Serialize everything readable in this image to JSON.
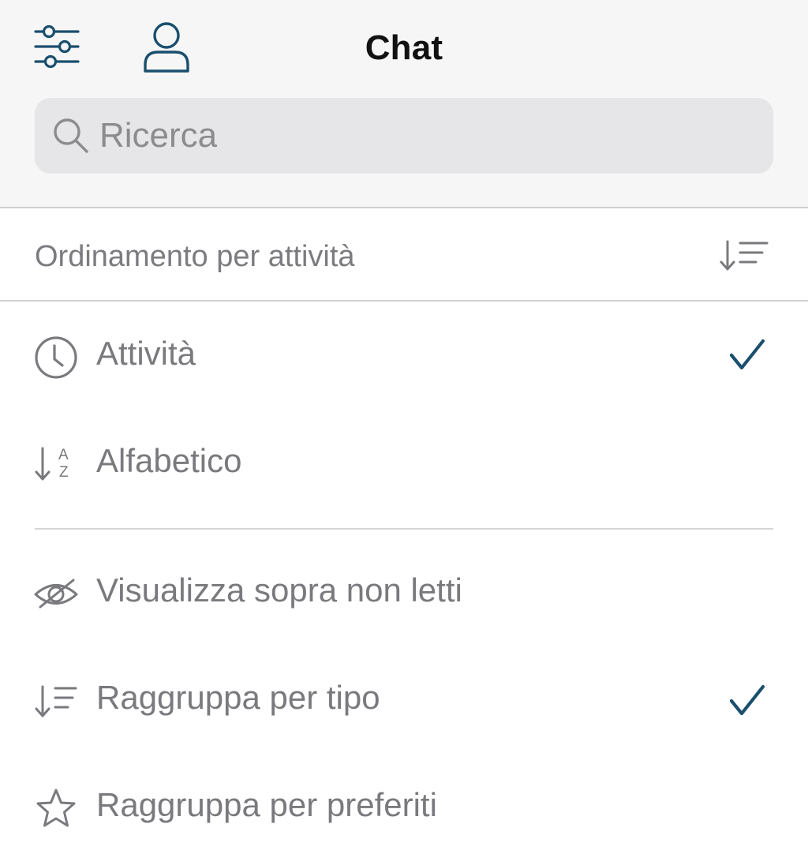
{
  "header": {
    "title": "Chat",
    "filters_icon": "sliders-icon",
    "profile_icon": "person-icon",
    "accent_color": "#1a4f6e"
  },
  "search": {
    "placeholder": "Ricerca",
    "value": "",
    "icon": "search-icon"
  },
  "sort_section": {
    "title": "Ordinamento per attività",
    "icon": "sort-lines-icon"
  },
  "sort_options": [
    {
      "label": "Attività",
      "icon": "clock-icon",
      "checked": true
    },
    {
      "label": "Alfabetico",
      "icon": "sort-az-icon",
      "checked": false
    }
  ],
  "view_options": [
    {
      "label": "Visualizza sopra non letti",
      "icon": "eye-off-icon",
      "checked": false
    },
    {
      "label": "Raggruppa per tipo",
      "icon": "sort-lines-icon",
      "checked": true
    },
    {
      "label": "Raggruppa per preferiti",
      "icon": "star-icon",
      "checked": false
    }
  ],
  "colors": {
    "header_bg": "#f6f6f6",
    "search_bg": "#e6e6e8",
    "text_muted": "#7a7a7e",
    "check": "#1a4f6e"
  }
}
